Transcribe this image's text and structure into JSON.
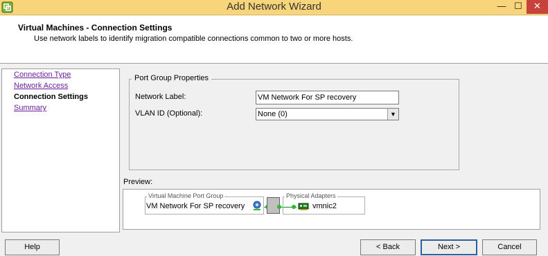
{
  "window": {
    "title": "Add Network Wizard",
    "controls": {
      "minimize": "—",
      "maximize": "☐",
      "close": "✕"
    }
  },
  "header": {
    "title": "Virtual Machines - Connection Settings",
    "subtitle": "Use network labels to identify migration compatible connections common to two or more hosts."
  },
  "nav": {
    "items": [
      {
        "label": "Connection Type",
        "state": "link"
      },
      {
        "label": "Network Access",
        "state": "link"
      },
      {
        "label": "Connection Settings",
        "state": "current"
      },
      {
        "label": "Summary",
        "state": "link"
      }
    ]
  },
  "port_group": {
    "legend": "Port Group Properties",
    "network_label": {
      "label": "Network Label:",
      "value": "VM Network For SP recovery"
    },
    "vlan_id": {
      "label": "VLAN ID (Optional):",
      "value": "None (0)"
    }
  },
  "preview": {
    "label": "Preview:",
    "vm_group_title": "Virtual Machine Port Group",
    "vm_group_name": "VM Network For SP recovery",
    "adapters_title": "Physical Adapters",
    "adapter_name": "vmnic2"
  },
  "buttons": {
    "help": "Help",
    "back": "< Back",
    "next": "Next >",
    "cancel": "Cancel"
  },
  "colors": {
    "titlebar": "#f8d47a",
    "link": "#6b1f9e",
    "connection_line": "#2fb82f",
    "default_button_border": "#2d5f9a"
  },
  "icons": {
    "app": "vsphere-app-icon",
    "vm": "virtual-machine-network-icon",
    "switch": "virtual-switch-icon",
    "nic": "network-adapter-icon"
  }
}
